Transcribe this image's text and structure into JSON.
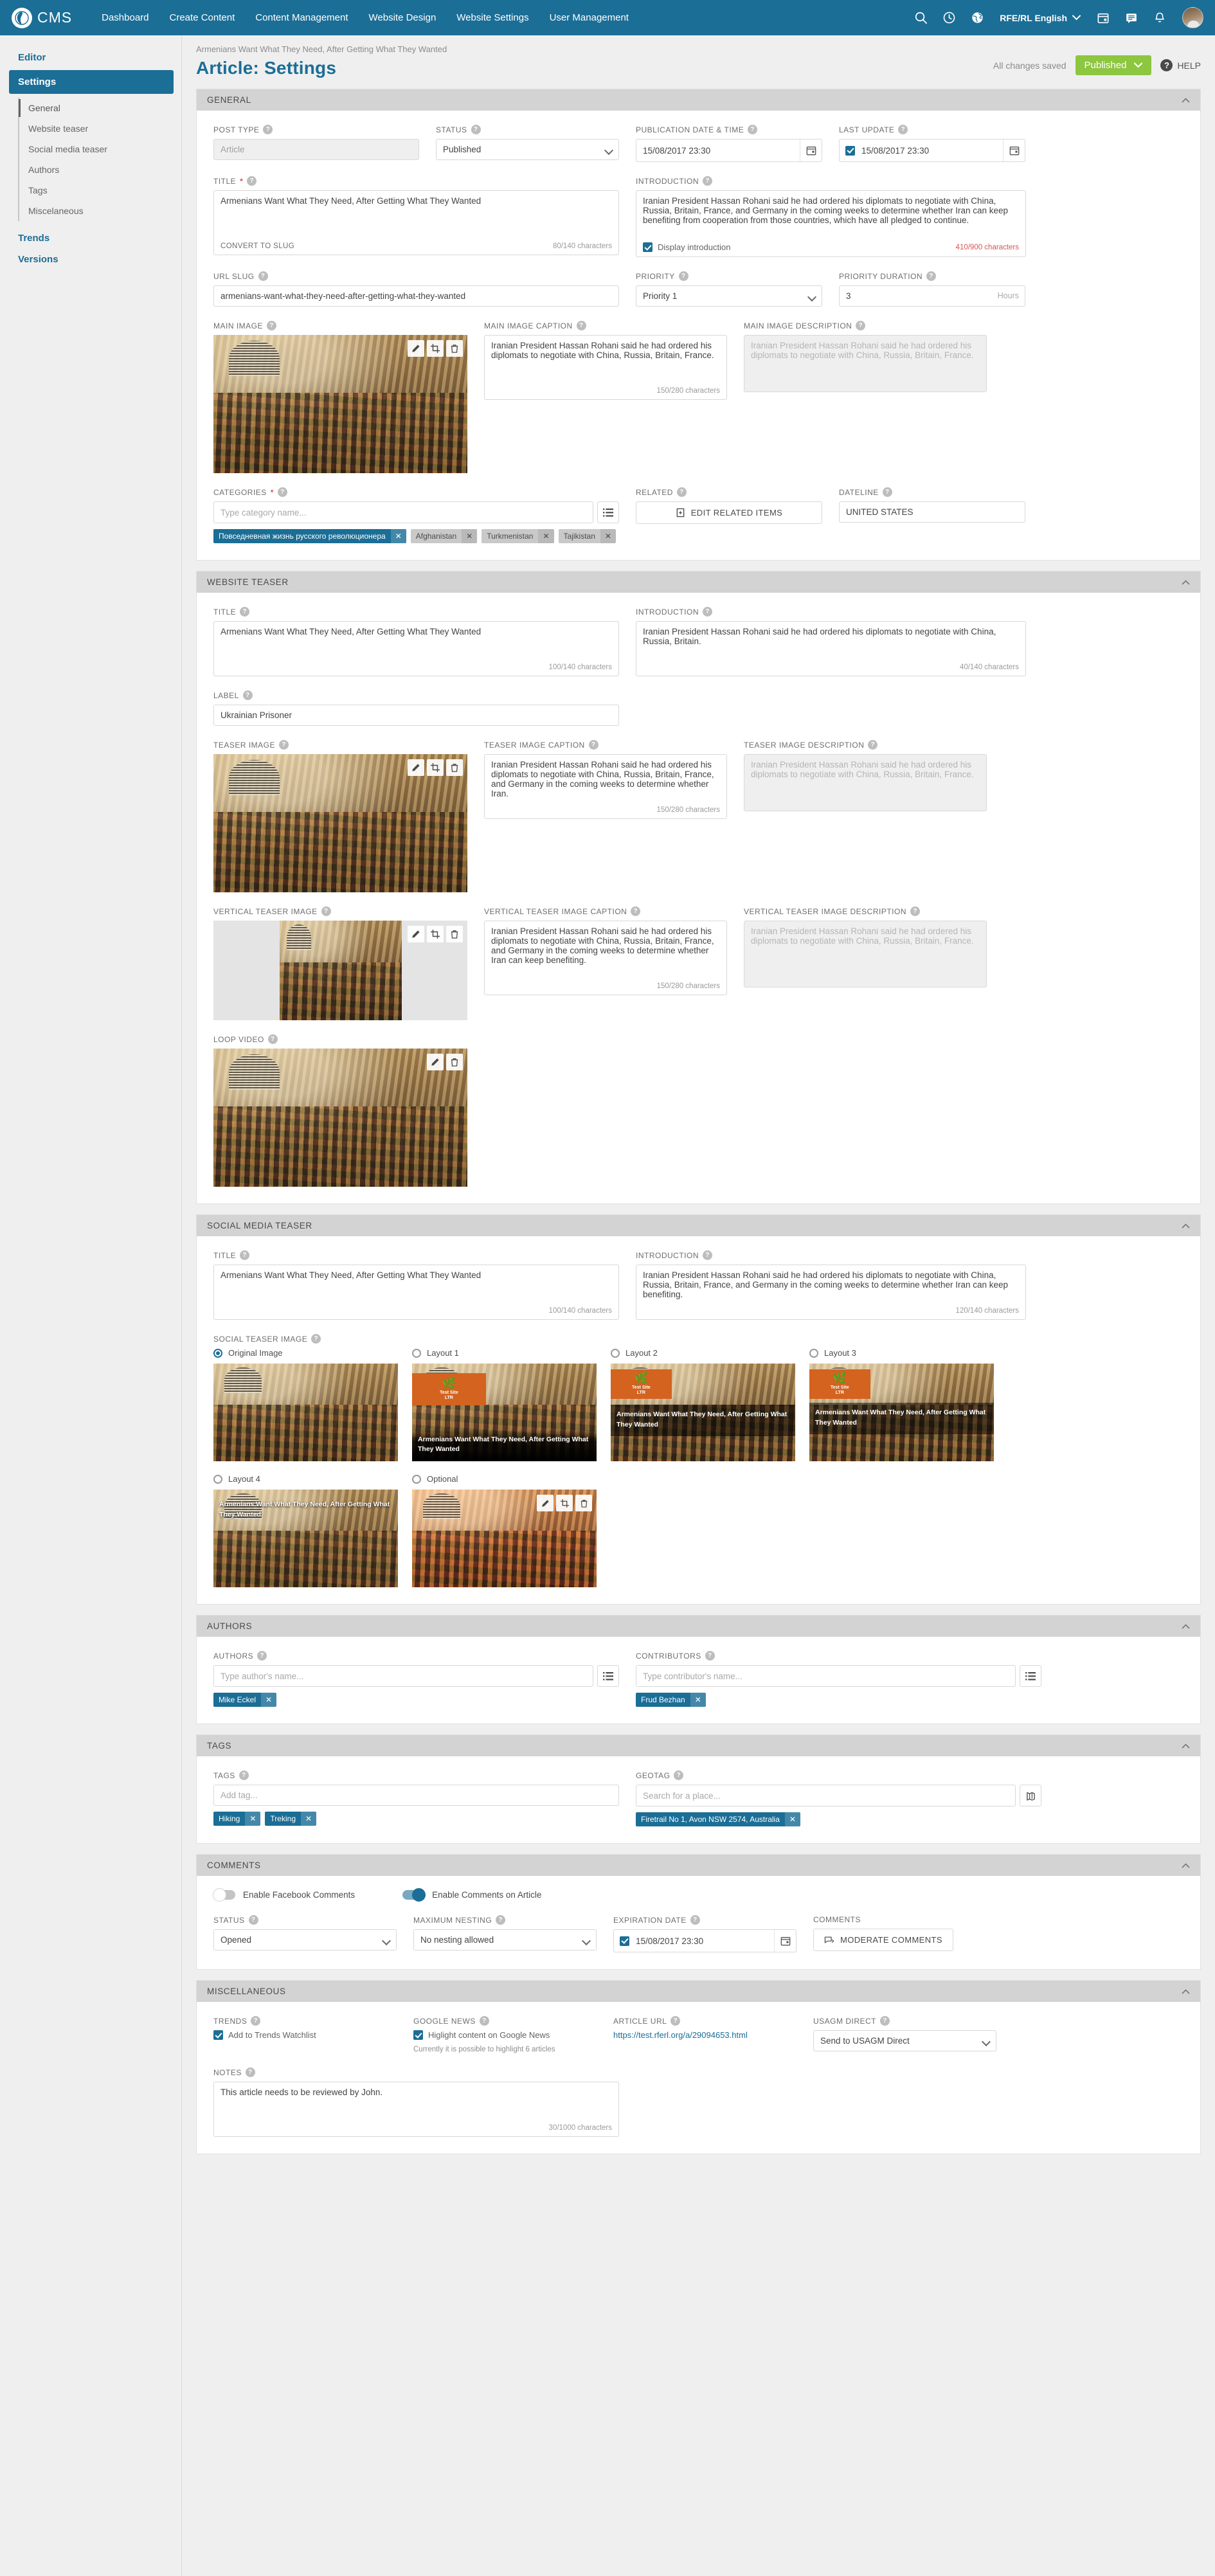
{
  "topnav": {
    "brand": "CMS",
    "links": [
      "Dashboard",
      "Create Content",
      "Content Management",
      "Website Design",
      "Website Settings",
      "User Management"
    ],
    "language": "RFE/RL English",
    "icons": [
      "search-icon",
      "history-clock-icon",
      "globe-icon",
      "calendar-icon",
      "chat-icon",
      "bell-icon"
    ]
  },
  "sidebar": {
    "editor": "Editor",
    "settings": "Settings",
    "sub": [
      "General",
      "Website teaser",
      "Social media teaser",
      "Authors",
      "Tags",
      "Miscelaneous"
    ],
    "trends": "Trends",
    "versions": "Versions"
  },
  "head": {
    "breadcrumb": "Armenians Want What They Need, After Getting What They Wanted",
    "title": "Article: Settings",
    "saved": "All changes saved",
    "publish": "Published",
    "help": "HELP"
  },
  "general": {
    "section": "GENERAL",
    "post_type_label": "POST TYPE",
    "post_type_value": "Article",
    "status_label": "STATUS",
    "status_value": "Published",
    "pubdate_label": "PUBLICATION DATE & TIME",
    "pubdate_value": "15/08/2017 23:30",
    "lastupdate_label": "LAST UPDATE",
    "lastupdate_value": "15/08/2017 23:30",
    "title_label": "TITLE",
    "title_value": "Armenians Want What They Need, After Getting What They Wanted",
    "convert_to_slug": "CONVERT TO SLUG",
    "title_counter": "80/140 characters",
    "intro_label": "INTRODUCTION",
    "intro_value": "Iranian President Hassan Rohani said he had ordered his diplomats to negotiate with China, Russia, Britain, France, and Germany in the coming weeks to determine whether Iran can keep benefiting from cooperation from those countries, which have all pledged to continue.",
    "intro_checkbox": "Display introduction",
    "intro_counter": "410/900 characters",
    "urlslug_label": "URL SLUG",
    "urlslug_value": "armenians-want-what-they-need-after-getting-what-they-wanted",
    "priority_label": "PRIORITY",
    "priority_value": "Priority 1",
    "priority_duration_label": "PRIORITY DURATION",
    "priority_duration_value": "3",
    "priority_duration_unit": "Hours",
    "main_image_label": "MAIN IMAGE",
    "main_image_caption_label": "MAIN IMAGE CAPTION",
    "main_image_caption_value": "Iranian President Hassan Rohani said he had ordered his diplomats to negotiate with China, Russia, Britain, France.",
    "main_image_caption_counter": "150/280 characters",
    "main_image_desc_label": "MAIN IMAGE DESCRIPTION",
    "main_image_desc_value": "Iranian President Hassan Rohani said he had ordered his diplomats to negotiate with China, Russia, Britain, France.",
    "categories_label": "CATEGORIES",
    "categories_placeholder": "Type category name...",
    "categories": [
      {
        "label": "Повседневная жизнь русского революционера",
        "selected": true
      },
      {
        "label": "Afghanistan",
        "selected": false
      },
      {
        "label": "Turkmenistan",
        "selected": false
      },
      {
        "label": "Tajikistan",
        "selected": false
      }
    ],
    "related_label": "RELATED",
    "related_button": "EDIT RELATED ITEMS",
    "dateline_label": "DATELINE",
    "dateline_value": "UNITED STATES"
  },
  "website_teaser": {
    "section": "WEBSITE TEASER",
    "title_label": "TITLE",
    "title_value": "Armenians Want What They Need, After Getting What They Wanted",
    "title_counter": "100/140 characters",
    "intro_label": "INTRODUCTION",
    "intro_value": "Iranian President Hassan Rohani said he had ordered his diplomats to negotiate with China, Russia, Britain.",
    "intro_counter": "40/140 characters",
    "label_label": "LABEL",
    "label_value": "Ukrainian Prisoner",
    "teaser_image_label": "TEASER IMAGE",
    "teaser_caption_label": "TEASER IMAGE CAPTION",
    "teaser_caption_value": "Iranian President Hassan Rohani said he had ordered his diplomats to negotiate with China, Russia, Britain, France, and Germany in the coming weeks to determine whether Iran.",
    "teaser_caption_counter": "150/280 characters",
    "teaser_desc_label": "TEASER IMAGE DESCRIPTION",
    "teaser_desc_value": "Iranian President Hassan Rohani said he had ordered his diplomats to negotiate with China, Russia, Britain, France.",
    "vertical_image_label": "VERTICAL TEASER IMAGE",
    "vertical_caption_label": "VERTICAL TEASER IMAGE CAPTION",
    "vertical_caption_value": "Iranian President Hassan Rohani said he had ordered his diplomats to negotiate with China, Russia, Britain, France, and Germany in the coming weeks to determine whether Iran can keep benefiting.",
    "vertical_caption_counter": "150/280 characters",
    "vertical_desc_label": "VERTICAL TEASER IMAGE DESCRIPTION",
    "vertical_desc_value": "Iranian President Hassan Rohani said he had ordered his diplomats to negotiate with China, Russia, Britain, France.",
    "loop_video_label": "LOOP VIDEO"
  },
  "social_teaser": {
    "section": "SOCIAL MEDIA TEASER",
    "title_label": "TITLE",
    "title_value": "Armenians Want What They Need, After Getting What They Wanted",
    "title_counter": "100/140 characters",
    "intro_label": "INTRODUCTION",
    "intro_value": "Iranian President Hassan Rohani said he had ordered his diplomats to negotiate with China, Russia, Britain, France, and Germany in the coming weeks to determine whether Iran can keep benefiting.",
    "intro_counter": "120/140 characters",
    "image_label": "SOCIAL TEASER IMAGE",
    "options": [
      {
        "label": "Original Image",
        "selected": true
      },
      {
        "label": "Layout 1",
        "selected": false
      },
      {
        "label": "Layout 2",
        "selected": false
      },
      {
        "label": "Layout 3",
        "selected": false
      },
      {
        "label": "Layout 4",
        "selected": false
      },
      {
        "label": "Optional",
        "selected": false
      }
    ],
    "card_title": "Armenians Want What They Need, After Getting What They Wanted",
    "logo_text": "Test Site\nLTR"
  },
  "authors": {
    "section": "AUTHORS",
    "authors_label": "AUTHORS",
    "authors_placeholder": "Type author's name...",
    "authors_chips": [
      "Mike Eckel"
    ],
    "contributors_label": "CONTRIBUTORS",
    "contributors_placeholder": "Type contributor's name...",
    "contributors_chips": [
      "Frud Bezhan"
    ]
  },
  "tags": {
    "section": "TAGS",
    "tags_label": "TAGS",
    "tags_placeholder": "Add tag...",
    "tags_chips": [
      "Hiking",
      "Treking"
    ],
    "geotag_label": "GEOTAG",
    "geotag_placeholder": "Search for a place...",
    "geotag_chips": [
      "Firetrail No 1, Avon NSW 2574, Australia"
    ]
  },
  "comments": {
    "section": "COMMENTS",
    "facebook_toggle": "Enable Facebook Comments",
    "facebook_on": false,
    "article_toggle": "Enable Comments on Article",
    "article_on": true,
    "status_label": "STATUS",
    "status_value": "Opened",
    "nesting_label": "MAXIMUM NESTING",
    "nesting_value": "No nesting allowed",
    "expiration_label": "EXPIRATION DATE",
    "expiration_value": "15/08/2017 23:30",
    "comments_label": "COMMENTS",
    "moderate_button": "MODERATE COMMENTS"
  },
  "misc": {
    "section": "MISCELLANEOUS",
    "trends_label": "TRENDS",
    "trends_checkbox": "Add to Trends Watchlist",
    "google_label": "GOOGLE NEWS",
    "google_checkbox": "Higlight content on Google News",
    "google_hint": "Currently it is possible to highlight 6 articles",
    "article_url_label": "ARTICLE URL",
    "article_url_value": "https://test.rferl.org/a/29094653.html",
    "usagm_label": "USAGM DIRECT",
    "usagm_value": "Send to USAGM Direct",
    "notes_label": "NOTES",
    "notes_value": "This article needs to be reviewed by John.",
    "notes_counter": "30/1000 characters"
  },
  "colors": {
    "brand": "#1b6e96",
    "publish": "#8dc63f",
    "warn": "#d9534f"
  }
}
